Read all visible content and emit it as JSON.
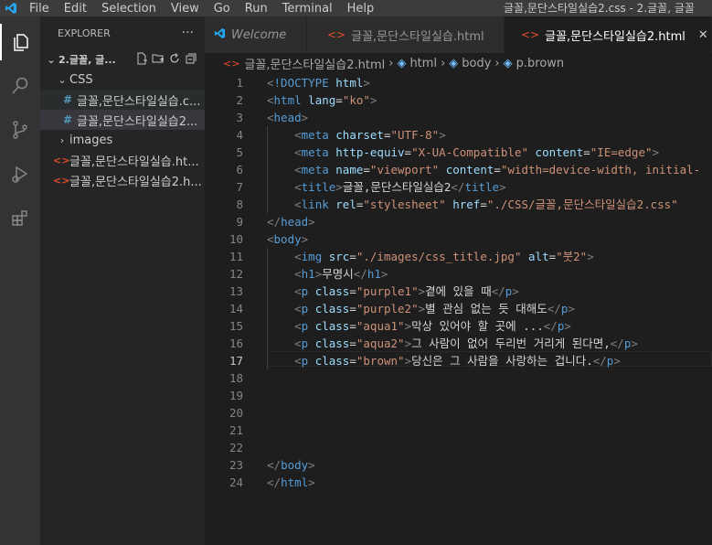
{
  "menu": [
    "File",
    "Edit",
    "Selection",
    "View",
    "Go",
    "Run",
    "Terminal",
    "Help"
  ],
  "window_title": "글꼴,문단스타일실습2.css - 2.글꼴, 글꼴",
  "explorer": {
    "header": "EXPLORER",
    "more": "···",
    "folder": "2.글꼴, 글...",
    "items": [
      {
        "label": "CSS",
        "type": "folder"
      },
      {
        "label": "글꼴,문단스타일실습.c...",
        "type": "css"
      },
      {
        "label": "글꼴,문단스타일실습2...",
        "type": "css"
      },
      {
        "label": "images",
        "type": "folder"
      },
      {
        "label": "글꼴,문단스타일실습.ht...",
        "type": "html"
      },
      {
        "label": "글꼴,문단스타일실습2.h...",
        "type": "html"
      }
    ]
  },
  "tabs": [
    {
      "label": "Welcome"
    },
    {
      "label": "글꼴,문단스타일실습.html"
    },
    {
      "label": "글꼴,문단스타일실습2.html"
    }
  ],
  "breadcrumb": [
    "글꼴,문단스타일실습2.html",
    "html",
    "body",
    "p.brown"
  ],
  "icons": {
    "explorer": "files-icon",
    "search": "search-icon",
    "scm": "source-control-icon",
    "debug": "run-debug-icon",
    "extensions": "extensions-icon"
  },
  "colors": {
    "tag": "#569cd6",
    "attr": "#9cdcfe",
    "string": "#ce9178",
    "text": "#d4d4d4"
  },
  "editor": {
    "current_line": 17,
    "lines": [
      [
        {
          "t": "punct",
          "v": "<"
        },
        {
          "t": "tag",
          "v": "!DOCTYPE "
        },
        {
          "t": "attr",
          "v": "html"
        },
        {
          "t": "punct",
          "v": ">"
        }
      ],
      [
        {
          "t": "punct",
          "v": "<"
        },
        {
          "t": "tag",
          "v": "html "
        },
        {
          "t": "attr",
          "v": "lang"
        },
        {
          "t": "text",
          "v": "="
        },
        {
          "t": "str",
          "v": "\"ko\""
        },
        {
          "t": "punct",
          "v": ">"
        }
      ],
      [
        {
          "t": "punct",
          "v": "<"
        },
        {
          "t": "tag",
          "v": "head"
        },
        {
          "t": "punct",
          "v": ">"
        }
      ],
      [
        {
          "t": "text",
          "v": "    "
        },
        {
          "t": "punct",
          "v": "<"
        },
        {
          "t": "tag",
          "v": "meta "
        },
        {
          "t": "attr",
          "v": "charset"
        },
        {
          "t": "text",
          "v": "="
        },
        {
          "t": "str",
          "v": "\"UTF-8\""
        },
        {
          "t": "punct",
          "v": ">"
        }
      ],
      [
        {
          "t": "text",
          "v": "    "
        },
        {
          "t": "punct",
          "v": "<"
        },
        {
          "t": "tag",
          "v": "meta "
        },
        {
          "t": "attr",
          "v": "http-equiv"
        },
        {
          "t": "text",
          "v": "="
        },
        {
          "t": "str",
          "v": "\"X-UA-Compatible\" "
        },
        {
          "t": "attr",
          "v": "content"
        },
        {
          "t": "text",
          "v": "="
        },
        {
          "t": "str",
          "v": "\"IE=edge\""
        },
        {
          "t": "punct",
          "v": ">"
        }
      ],
      [
        {
          "t": "text",
          "v": "    "
        },
        {
          "t": "punct",
          "v": "<"
        },
        {
          "t": "tag",
          "v": "meta "
        },
        {
          "t": "attr",
          "v": "name"
        },
        {
          "t": "text",
          "v": "="
        },
        {
          "t": "str",
          "v": "\"viewport\" "
        },
        {
          "t": "attr",
          "v": "content"
        },
        {
          "t": "text",
          "v": "="
        },
        {
          "t": "str",
          "v": "\"width=device-width, initial-"
        }
      ],
      [
        {
          "t": "text",
          "v": "    "
        },
        {
          "t": "punct",
          "v": "<"
        },
        {
          "t": "tag",
          "v": "title"
        },
        {
          "t": "punct",
          "v": ">"
        },
        {
          "t": "text",
          "v": "글꼴,문단스타일실습2"
        },
        {
          "t": "punct",
          "v": "</"
        },
        {
          "t": "tag",
          "v": "title"
        },
        {
          "t": "punct",
          "v": ">"
        }
      ],
      [
        {
          "t": "text",
          "v": "    "
        },
        {
          "t": "punct",
          "v": "<"
        },
        {
          "t": "tag",
          "v": "link "
        },
        {
          "t": "attr",
          "v": "rel"
        },
        {
          "t": "text",
          "v": "="
        },
        {
          "t": "str",
          "v": "\"stylesheet\" "
        },
        {
          "t": "attr",
          "v": "href"
        },
        {
          "t": "text",
          "v": "="
        },
        {
          "t": "str",
          "v": "\"./CSS/글꼴,문단스타일실습2.css\""
        }
      ],
      [
        {
          "t": "punct",
          "v": "</"
        },
        {
          "t": "tag",
          "v": "head"
        },
        {
          "t": "punct",
          "v": ">"
        }
      ],
      [
        {
          "t": "punct",
          "v": "<"
        },
        {
          "t": "tag",
          "v": "body"
        },
        {
          "t": "punct",
          "v": ">"
        }
      ],
      [
        {
          "t": "text",
          "v": "    "
        },
        {
          "t": "punct",
          "v": "<"
        },
        {
          "t": "tag",
          "v": "img "
        },
        {
          "t": "attr",
          "v": "src"
        },
        {
          "t": "text",
          "v": "="
        },
        {
          "t": "str",
          "v": "\"./images/css_title.jpg\" "
        },
        {
          "t": "attr",
          "v": "alt"
        },
        {
          "t": "text",
          "v": "="
        },
        {
          "t": "str",
          "v": "\"붓2\""
        },
        {
          "t": "punct",
          "v": ">"
        }
      ],
      [
        {
          "t": "text",
          "v": "    "
        },
        {
          "t": "punct",
          "v": "<"
        },
        {
          "t": "tag",
          "v": "h1"
        },
        {
          "t": "punct",
          "v": ">"
        },
        {
          "t": "text",
          "v": "무명시"
        },
        {
          "t": "punct",
          "v": "</"
        },
        {
          "t": "tag",
          "v": "h1"
        },
        {
          "t": "punct",
          "v": ">"
        }
      ],
      [
        {
          "t": "text",
          "v": "    "
        },
        {
          "t": "punct",
          "v": "<"
        },
        {
          "t": "tag",
          "v": "p "
        },
        {
          "t": "attr",
          "v": "class"
        },
        {
          "t": "text",
          "v": "="
        },
        {
          "t": "str",
          "v": "\"purple1\""
        },
        {
          "t": "punct",
          "v": ">"
        },
        {
          "t": "text",
          "v": "곁에 있을 때"
        },
        {
          "t": "punct",
          "v": "</"
        },
        {
          "t": "tag",
          "v": "p"
        },
        {
          "t": "punct",
          "v": ">"
        }
      ],
      [
        {
          "t": "text",
          "v": "    "
        },
        {
          "t": "punct",
          "v": "<"
        },
        {
          "t": "tag",
          "v": "p "
        },
        {
          "t": "attr",
          "v": "class"
        },
        {
          "t": "text",
          "v": "="
        },
        {
          "t": "str",
          "v": "\"purple2\""
        },
        {
          "t": "punct",
          "v": ">"
        },
        {
          "t": "text",
          "v": "별 관심 없는 듯 대해도"
        },
        {
          "t": "punct",
          "v": "</"
        },
        {
          "t": "tag",
          "v": "p"
        },
        {
          "t": "punct",
          "v": ">"
        }
      ],
      [
        {
          "t": "text",
          "v": "    "
        },
        {
          "t": "punct",
          "v": "<"
        },
        {
          "t": "tag",
          "v": "p "
        },
        {
          "t": "attr",
          "v": "class"
        },
        {
          "t": "text",
          "v": "="
        },
        {
          "t": "str",
          "v": "\"aqua1\""
        },
        {
          "t": "punct",
          "v": ">"
        },
        {
          "t": "text",
          "v": "막상 있어야 할 곳에 ..."
        },
        {
          "t": "punct",
          "v": "</"
        },
        {
          "t": "tag",
          "v": "p"
        },
        {
          "t": "punct",
          "v": ">"
        }
      ],
      [
        {
          "t": "text",
          "v": "    "
        },
        {
          "t": "punct",
          "v": "<"
        },
        {
          "t": "tag",
          "v": "p "
        },
        {
          "t": "attr",
          "v": "class"
        },
        {
          "t": "text",
          "v": "="
        },
        {
          "t": "str",
          "v": "\"aqua2\""
        },
        {
          "t": "punct",
          "v": ">"
        },
        {
          "t": "text",
          "v": "그 사람이 없어 두리번 거리게 된다면,"
        },
        {
          "t": "punct",
          "v": "</"
        },
        {
          "t": "tag",
          "v": "p"
        },
        {
          "t": "punct",
          "v": ">"
        }
      ],
      [
        {
          "t": "text",
          "v": "    "
        },
        {
          "t": "punct",
          "v": "<"
        },
        {
          "t": "tag",
          "v": "p "
        },
        {
          "t": "attr",
          "v": "class"
        },
        {
          "t": "text",
          "v": "="
        },
        {
          "t": "str",
          "v": "\"brown\""
        },
        {
          "t": "punct",
          "v": ">"
        },
        {
          "t": "text",
          "v": "당신은 그 사람을 사랑하는 겁니다."
        },
        {
          "t": "punct",
          "v": "</"
        },
        {
          "t": "tag",
          "v": "p"
        },
        {
          "t": "punct",
          "v": ">"
        }
      ],
      [],
      [],
      [],
      [],
      [],
      [
        {
          "t": "punct",
          "v": "</"
        },
        {
          "t": "tag",
          "v": "body"
        },
        {
          "t": "punct",
          "v": ">"
        }
      ],
      [
        {
          "t": "punct",
          "v": "</"
        },
        {
          "t": "tag",
          "v": "html"
        },
        {
          "t": "punct",
          "v": ">"
        }
      ]
    ]
  }
}
